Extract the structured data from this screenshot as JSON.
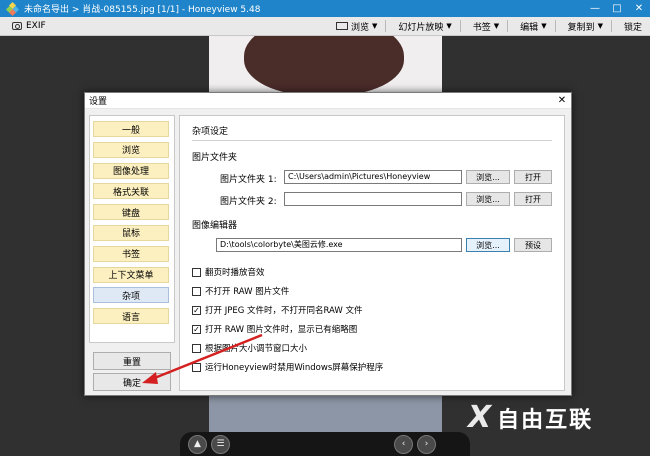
{
  "window": {
    "title": "未命名导出 > 肖战-085155.jpg [1/1] - Honeyview 5.48",
    "controls": [
      "minimize-icon",
      "maximize-icon",
      "close-icon"
    ]
  },
  "toolbar": {
    "exif_label": "EXIF",
    "items": [
      "浏览",
      "幻灯片放映",
      "书签",
      "编辑",
      "复制到",
      "锁定"
    ]
  },
  "dialog": {
    "title": "设置",
    "sidebar": {
      "items": [
        "一般",
        "浏览",
        "图像处理",
        "格式关联",
        "键盘",
        "鼠标",
        "书签",
        "上下文菜单",
        "杂项",
        "语言"
      ],
      "selected_index": 8,
      "reset_label": "重置",
      "ok_label": "确定"
    },
    "content": {
      "header": "杂项设定",
      "folders": {
        "title": "图片文件夹",
        "folder1_label": "图片文件夹 1:",
        "folder1_value": "C:\\Users\\admin\\Pictures\\Honeyview",
        "folder2_label": "图片文件夹 2:",
        "folder2_value": "",
        "browse_label": "浏览...",
        "open_label": "打开"
      },
      "editor": {
        "title": "图像编辑器",
        "path_value": "D:\\tools\\colorbyte\\美图云修.exe",
        "browse_label": "浏览...",
        "preset_label": "预设"
      },
      "checkboxes": [
        {
          "label": "翻页时播放音效",
          "checked": false
        },
        {
          "label": "不打开 RAW 图片文件",
          "checked": false
        },
        {
          "label": "打开 JPEG 文件时，不打开同名RAW 文件",
          "checked": true
        },
        {
          "label": "打开 RAW 图片文件时，显示已有缩略图",
          "checked": true
        },
        {
          "label": "根据图片大小调节窗口大小",
          "checked": false
        },
        {
          "label": "运行Honeyview时禁用Windows屏幕保护程序",
          "checked": false
        }
      ]
    }
  },
  "watermark": {
    "text": "自由互联"
  },
  "colors": {
    "titlebar": "#1f84c9",
    "arrow": "#d42020",
    "sidebar_item": "#fdf0c0"
  }
}
